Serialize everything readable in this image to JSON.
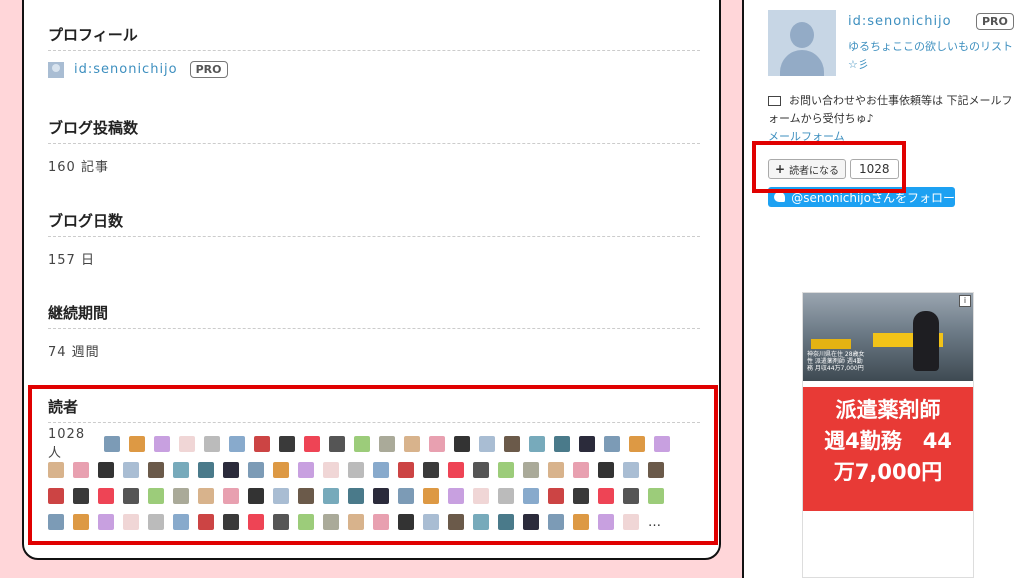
{
  "profile": {
    "title": "プロフィール",
    "id": "id:senonichijo",
    "pro": "PRO"
  },
  "posts": {
    "title": "ブログ投稿数",
    "value": "160 記事"
  },
  "days": {
    "title": "ブログ日数",
    "value": "157 日"
  },
  "period": {
    "title": "継続期間",
    "value": "74 週間"
  },
  "readers": {
    "title": "読者",
    "count": "1028 人",
    "more": "…"
  },
  "sidebar": {
    "id": "id:senonichijo",
    "pro": "PRO",
    "description": "ゆるちょここの欲しいものリスト☆彡",
    "contact": "お問い合わせやお仕事依頼等は 下記メールフォームから受付ちゅ♪",
    "mail_link": "メールフォーム",
    "subscribe_label": "読者になる",
    "subscriber_count": "1028",
    "twitter_label": "@senonichijoさんをフォロー"
  },
  "ad": {
    "caption": "神奈川県在住 28歳女性 派遣薬剤師 週4勤務 月収44万7,000円",
    "line1": "派遣薬剤師",
    "line2": "週4勤務　44",
    "line3": "万7,000円"
  },
  "colors": {
    "accent": "#3d8fbf",
    "highlight": "#e00000",
    "background": "#ffd6d9",
    "twitter": "#1da1f2",
    "ad_red": "#e83a36"
  }
}
